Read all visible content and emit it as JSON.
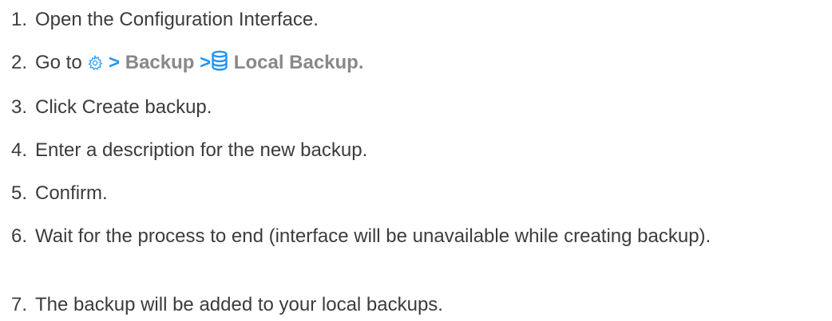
{
  "steps": [
    {
      "num": "1.",
      "text": "Open the Configuration Interface."
    },
    {
      "num": "2.",
      "prefix": "Go to",
      "path": [
        "Backup",
        "Local Backup."
      ],
      "sep": ">",
      "icons": [
        "gear-icon",
        "database-icon"
      ]
    },
    {
      "num": "3.",
      "text": "Click Create backup."
    },
    {
      "num": "4.",
      "text": "Enter a description for the new backup."
    },
    {
      "num": "5.",
      "text": "Confirm."
    },
    {
      "num": "6.",
      "text": "Wait for the process to end (interface will be unavailable while creating backup)."
    },
    {
      "num": "7.",
      "text": "The backup will be added to your local backups."
    }
  ],
  "colors": {
    "text": "#3c3c3c",
    "accent": "#2196f3",
    "path": "#888888"
  }
}
